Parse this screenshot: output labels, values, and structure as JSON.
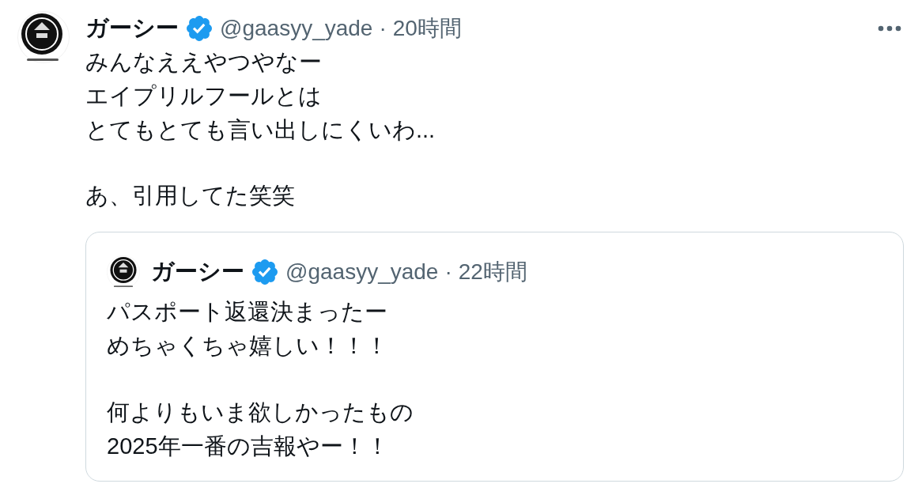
{
  "tweet": {
    "author": {
      "name": "ガーシー",
      "verified": true,
      "handle": "@gaasyy_yade",
      "separator": "·",
      "time": "20時間"
    },
    "paragraphs": [
      [
        "みんなええやつやなー",
        "エイプリルフールとは",
        "とてもとても言い出しにくいわ..."
      ],
      [
        "あ、引用してた笑笑"
      ]
    ],
    "quoted_tweet": {
      "author": {
        "name": "ガーシー",
        "verified": true,
        "handle": "@gaasyy_yade",
        "separator": "·",
        "time": "22時間"
      },
      "paragraphs": [
        [
          "パスポート返還決まったー",
          "めちゃくちゃ嬉しい！！！"
        ],
        [
          "何よりもいま欲しかったもの",
          "2025年一番の吉報やー！！"
        ]
      ]
    }
  }
}
